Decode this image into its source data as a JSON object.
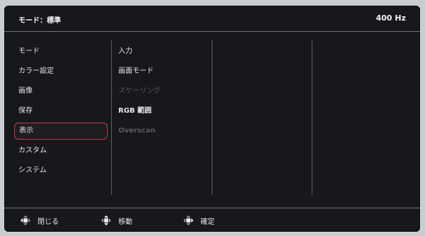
{
  "header": {
    "mode_label": "モード：標準",
    "refresh_rate": "400 Hz"
  },
  "menu": {
    "items": [
      {
        "label": "モード"
      },
      {
        "label": "カラー設定"
      },
      {
        "label": "画像"
      },
      {
        "label": "保存"
      },
      {
        "label": "表示"
      },
      {
        "label": "カスタム"
      },
      {
        "label": "システム"
      }
    ],
    "selected_index": 4
  },
  "submenu": {
    "items": [
      {
        "label": "入力",
        "enabled": true
      },
      {
        "label": "画面モード",
        "enabled": true
      },
      {
        "label": "スケーリング",
        "enabled": false
      },
      {
        "label": "RGB 範囲",
        "enabled": true
      },
      {
        "label": "Overscan",
        "enabled": false
      }
    ]
  },
  "footer": {
    "close_label": "閉じる",
    "move_label": "移動",
    "confirm_label": "確定"
  },
  "colors": {
    "background": "#17181c",
    "selection_border": "#c63b43",
    "disabled_text": "#5a5b60"
  }
}
